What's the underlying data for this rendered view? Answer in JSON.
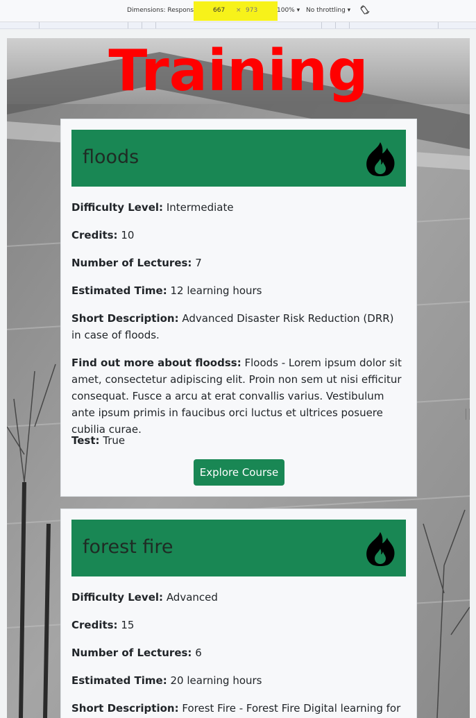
{
  "devtools": {
    "dimensions_label": "Dimensions: Responsive ▾",
    "width": "667",
    "times": "×",
    "height": "973",
    "zoom": "100% ▾",
    "throttling": "No throttling ▾",
    "icons": {
      "rotate": "rotate-icon"
    }
  },
  "page": {
    "title": "Training",
    "colors": {
      "title": "#ff0000",
      "card_header": "#198754",
      "button": "#198754"
    }
  },
  "courses": [
    {
      "name": "floods",
      "icon": "fire-icon",
      "difficulty_label": "Difficulty Level:",
      "difficulty": "Intermediate",
      "credits_label": "Credits:",
      "credits": "10",
      "lectures_label": "Number of Lectures:",
      "lectures": "7",
      "time_label": "Estimated Time:",
      "time": "12 learning hours",
      "short_desc_label": "Short Description:",
      "short_desc": "Advanced Disaster Risk Reduction (DRR) in case of floods.",
      "more_label": "Find out more about floodss:",
      "more": "Floods - Lorem ipsum dolor sit amet, consectetur adipiscing elit. Proin non sem ut nisi efficitur consequat. Fusce a arcu at erat convallis varius. Vestibulum ante ipsum primis in faucibus orci luctus et ultrices posuere cubilia curae.",
      "test_label": "Test:",
      "test": "True",
      "button": "Explore Course"
    },
    {
      "name": "forest fire",
      "icon": "fire-icon",
      "difficulty_label": "Difficulty Level:",
      "difficulty": "Advanced",
      "credits_label": "Credits:",
      "credits": "15",
      "lectures_label": "Number of Lectures:",
      "lectures": "6",
      "time_label": "Estimated Time:",
      "time": "20 learning hours",
      "short_desc_label": "Short Description:",
      "short_desc": "Forest Fire - Forest Fire Digital learning for"
    }
  ]
}
